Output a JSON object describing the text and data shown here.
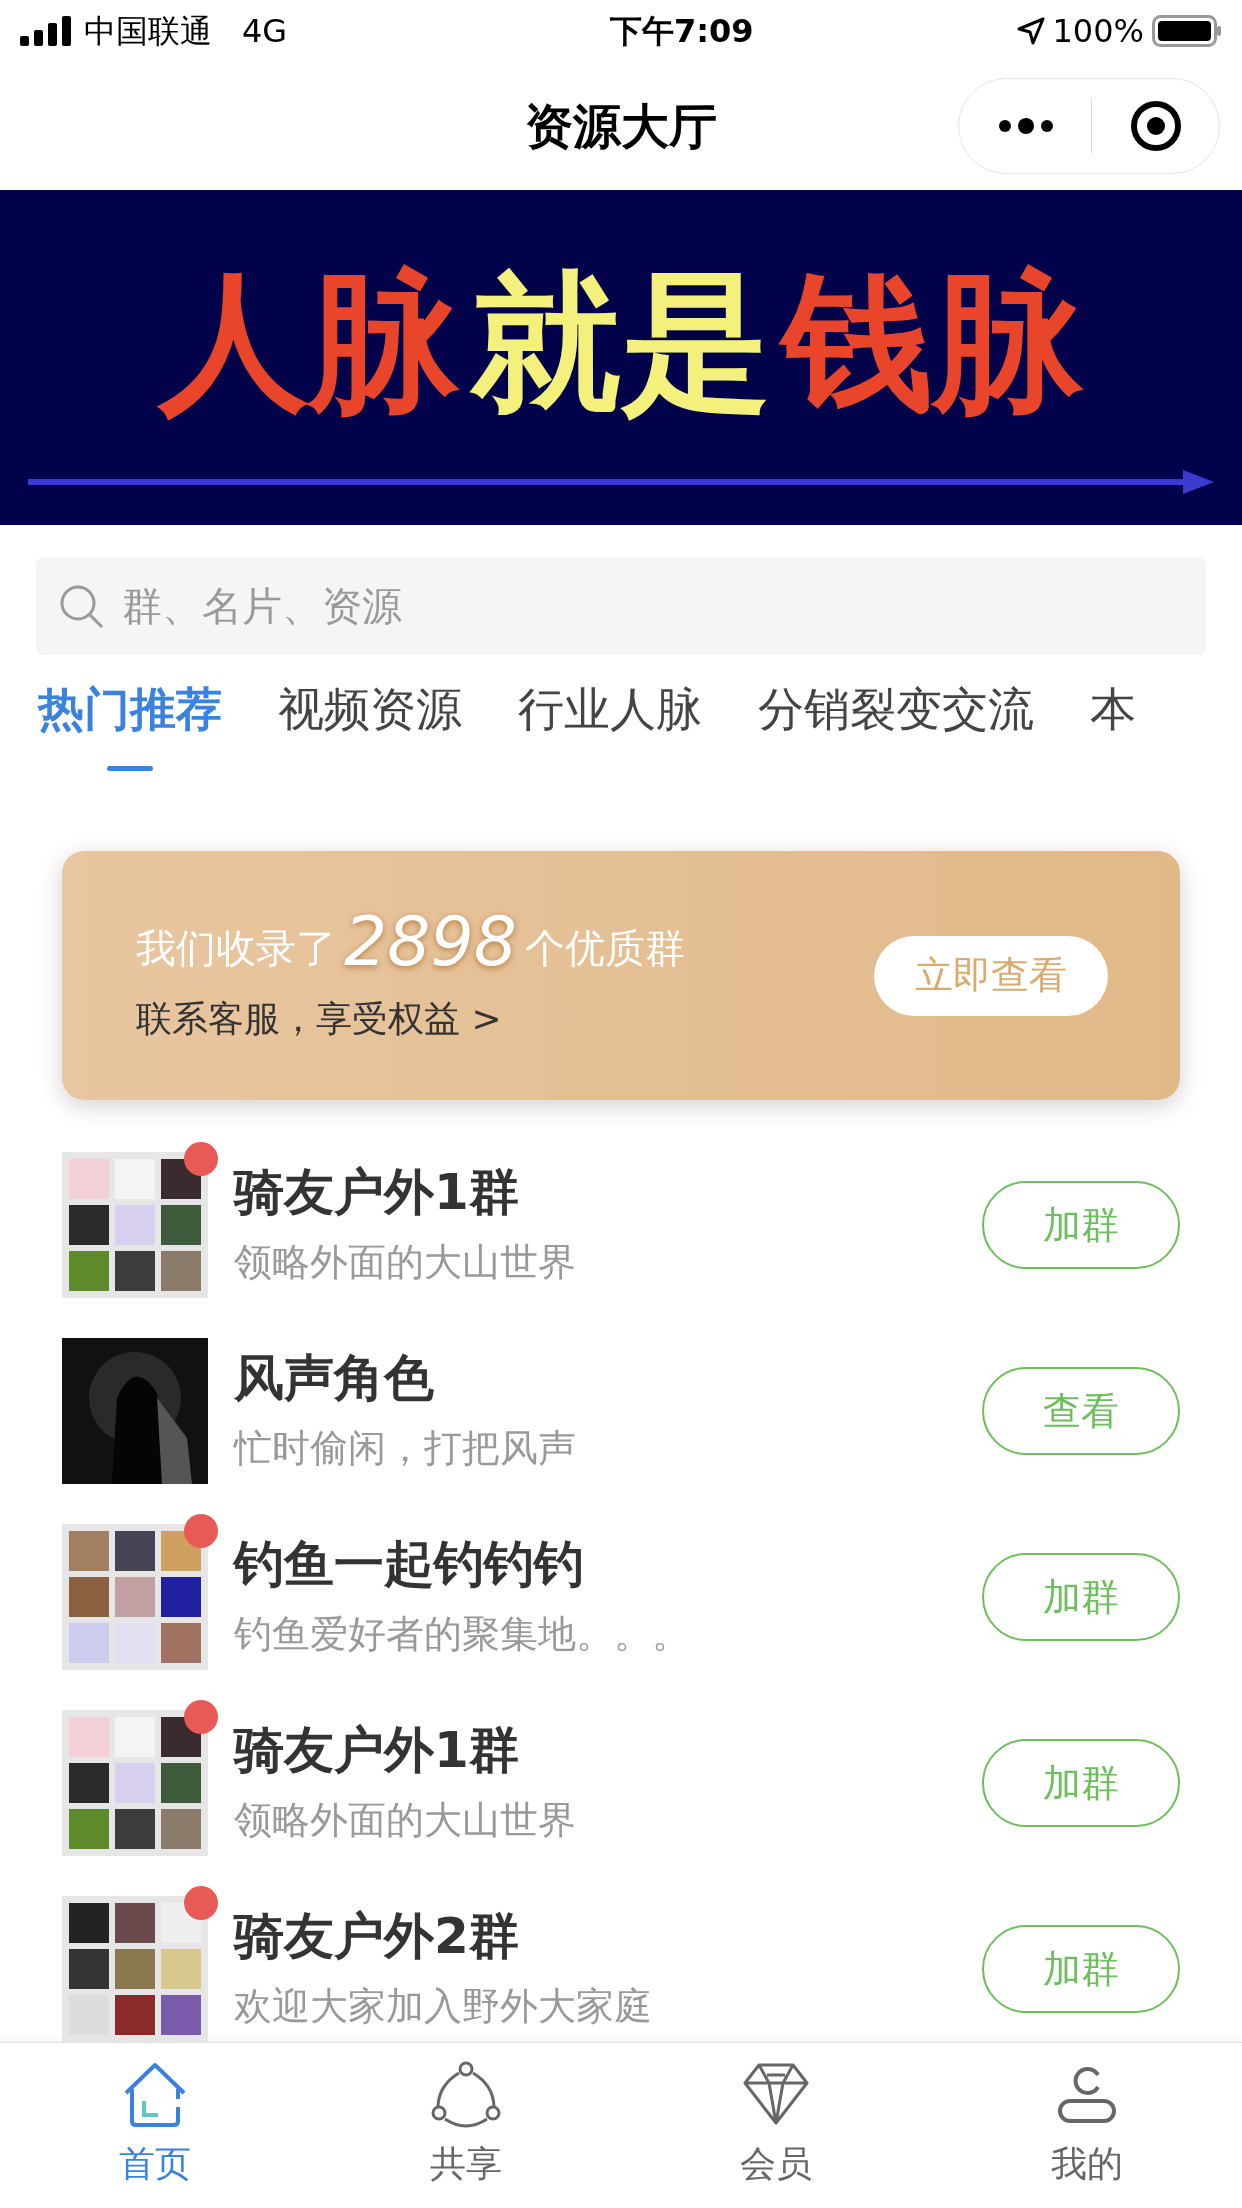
{
  "status_bar": {
    "carrier": "中国联通",
    "network": "4G",
    "time": "下午7:09",
    "battery": "100%"
  },
  "nav_bar": {
    "title": "资源大厅"
  },
  "banner": {
    "segments": [
      {
        "text": "人脉",
        "color": "#e8452a"
      },
      {
        "text": "就是",
        "color": "#f3f07c"
      },
      {
        "text": "钱脉",
        "color": "#e8452a"
      }
    ]
  },
  "search": {
    "placeholder": "群、名片、资源"
  },
  "tabs": [
    {
      "label": "热门推荐",
      "selected": true
    },
    {
      "label": "视频资源",
      "selected": false
    },
    {
      "label": "行业人脉",
      "selected": false
    },
    {
      "label": "分销裂变交流",
      "selected": false
    },
    {
      "label": "本",
      "selected": false
    }
  ],
  "promo": {
    "prefix": "我们收录了",
    "count": "2898",
    "suffix": "个优质群",
    "link": "联系客服，享受权益 >",
    "button": "立即查看"
  },
  "groups": [
    {
      "name": "骑友户外1群",
      "desc": "领略外面的大山世界",
      "button": "加群",
      "unread": true
    },
    {
      "name": "风声角色",
      "desc": "忙时偷闲，打把风声",
      "button": "查看",
      "unread": false
    },
    {
      "name": "钓鱼一起钓钓钓",
      "desc": "钓鱼爱好者的聚集地。。。",
      "button": "加群",
      "unread": true
    },
    {
      "name": "骑友户外1群",
      "desc": "领略外面的大山世界",
      "button": "加群",
      "unread": true
    },
    {
      "name": "骑友户外2群",
      "desc": "欢迎大家加入野外大家庭",
      "button": "加群",
      "unread": true
    }
  ],
  "tab_bar": [
    {
      "label": "首页",
      "selected": true
    },
    {
      "label": "共享",
      "selected": false
    },
    {
      "label": "会员",
      "selected": false
    },
    {
      "label": "我的",
      "selected": false
    }
  ]
}
